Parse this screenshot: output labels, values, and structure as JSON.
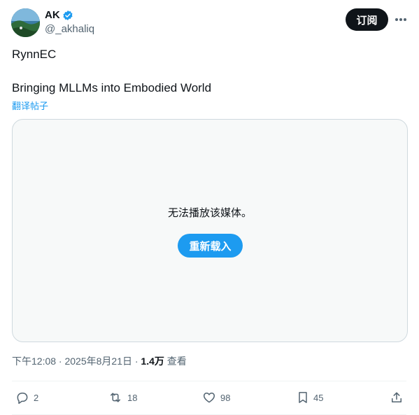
{
  "author": {
    "display_name": "AK",
    "handle": "@_akhaliq",
    "verified": true
  },
  "header": {
    "subscribe_label": "订阅"
  },
  "post": {
    "line1": "RynnEC",
    "line2": "Bringing MLLMs into Embodied World",
    "translate_label": "翻译帖子"
  },
  "media": {
    "error_message": "无法播放该媒体。",
    "reload_label": "重新载入"
  },
  "meta": {
    "timestamp": "下午12:08 · 2025年8月21日 · ",
    "views_count": "1.4万",
    "views_label": " 查看"
  },
  "actions": {
    "replies": "2",
    "reposts": "18",
    "likes": "98",
    "bookmarks": "45"
  },
  "colors": {
    "accent": "#1d9bf0",
    "text_primary": "#0f1419",
    "text_secondary": "#536471",
    "border": "#cfd9de"
  }
}
